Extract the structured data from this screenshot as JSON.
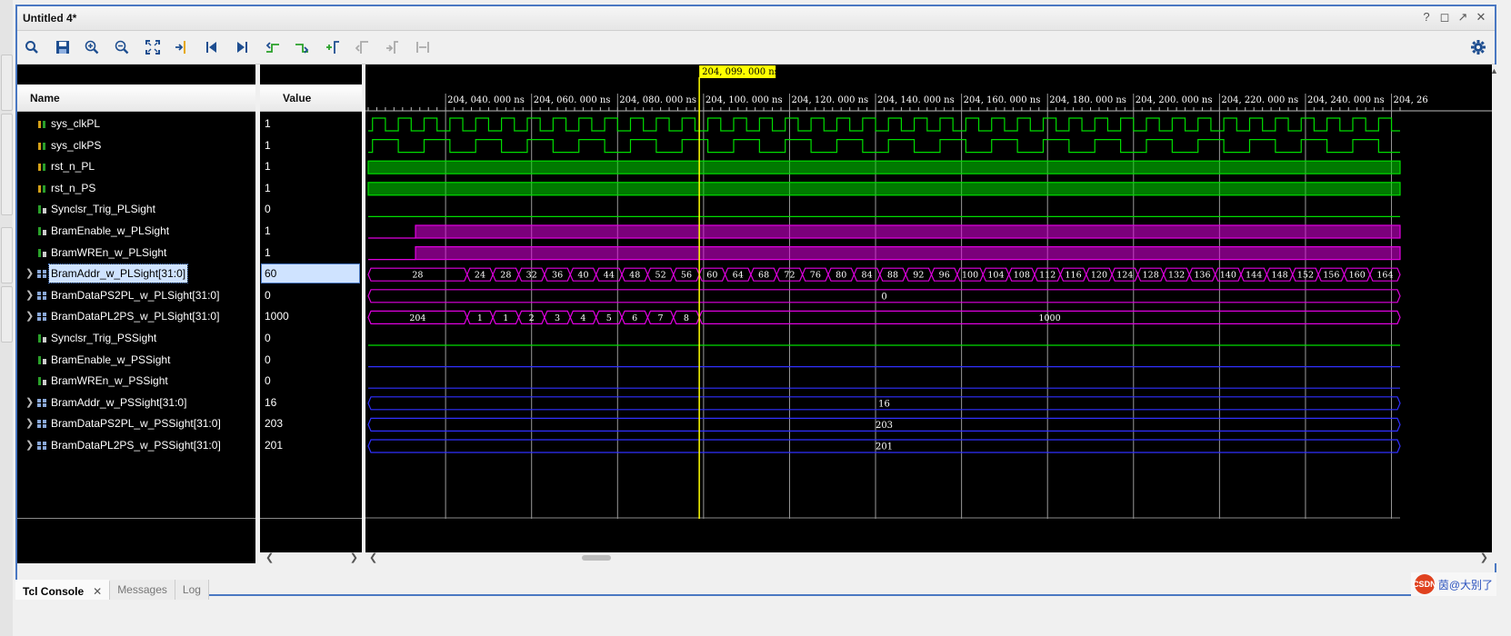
{
  "window": {
    "title": "Untitled 4*"
  },
  "title_controls": [
    "help-icon",
    "restore-icon",
    "float-icon",
    "close-icon"
  ],
  "toolbar": {
    "icons": [
      "search-icon",
      "save-icon",
      "zoom-in-icon",
      "zoom-out-icon",
      "zoom-fit-icon",
      "go-to-cursor-icon",
      "go-to-time-0-icon",
      "go-to-last-time-icon",
      "previous-transition-icon",
      "next-transition-icon",
      "add-marker-icon",
      "previous-marker-icon",
      "next-marker-icon",
      "swap-cursors-icon"
    ],
    "settings_icon": "gear-icon"
  },
  "headers": {
    "name": "Name",
    "value": "Value"
  },
  "signals": [
    {
      "name": "sys_clkPL",
      "value": "1",
      "type": "clock",
      "expand": false,
      "icon": "bit-signal-icon"
    },
    {
      "name": "sys_clkPS",
      "value": "1",
      "type": "clock",
      "expand": false,
      "icon": "bit-signal-icon"
    },
    {
      "name": "rst_n_PL",
      "value": "1",
      "type": "bit-high",
      "expand": false,
      "icon": "bit-signal-icon"
    },
    {
      "name": "rst_n_PS",
      "value": "1",
      "type": "bit-high",
      "expand": false,
      "icon": "bit-signal-icon"
    },
    {
      "name": "Synclsr_Trig_PLSight",
      "value": "0",
      "type": "bit-low",
      "expand": false,
      "icon": "wire-signal-icon"
    },
    {
      "name": "BramEnable_w_PLSight",
      "value": "1",
      "type": "bit-rise",
      "expand": false,
      "icon": "wire-signal-icon"
    },
    {
      "name": "BramWREn_w_PLSight",
      "value": "1",
      "type": "bit-rise",
      "expand": false,
      "icon": "wire-signal-icon"
    },
    {
      "name": "BramAddr_w_PLSight[31:0]",
      "value": "60",
      "type": "bus-addr",
      "expand": true,
      "icon": "bus-signal-icon",
      "selected": true
    },
    {
      "name": "BramDataPS2PL_w_PLSight[31:0]",
      "value": "0",
      "type": "bus-const",
      "expand": true,
      "icon": "bus-signal-icon"
    },
    {
      "name": "BramDataPL2PS_w_PLSight[31:0]",
      "value": "1000",
      "type": "bus-data",
      "expand": true,
      "icon": "bus-signal-icon"
    },
    {
      "name": "Synclsr_Trig_PSSight",
      "value": "0",
      "type": "bit-low",
      "expand": false,
      "icon": "wire-signal-icon"
    },
    {
      "name": "BramEnable_w_PSSight",
      "value": "0",
      "type": "bit-low-blue",
      "expand": false,
      "icon": "wire-signal-icon"
    },
    {
      "name": "BramWREn_w_PSSight",
      "value": "0",
      "type": "bit-low-blue",
      "expand": false,
      "icon": "wire-signal-icon"
    },
    {
      "name": "BramAddr_w_PSSight[31:0]",
      "value": "16",
      "type": "bus-blue",
      "expand": true,
      "icon": "bus-signal-icon"
    },
    {
      "name": "BramDataPS2PL_w_PSSight[31:0]",
      "value": "203",
      "type": "bus-blue",
      "expand": true,
      "icon": "bus-signal-icon"
    },
    {
      "name": "BramDataPL2PS_w_PSSight[31:0]",
      "value": "201",
      "type": "bus-blue",
      "expand": true,
      "icon": "bus-signal-icon"
    }
  ],
  "waveform": {
    "cursor_label": "204, 099. 000 ns",
    "cursor_time_ns": 204099,
    "view_start_ns": 204022,
    "view_end_ns": 204262,
    "time_labels": [
      "204, 040. 000 ns",
      "204, 060. 000 ns",
      "204, 080. 000 ns",
      "204, 100. 000 ns",
      "204, 120. 000 ns",
      "204, 140. 000 ns",
      "204, 160. 000 ns",
      "204, 180. 000 ns",
      "204, 200. 000 ns",
      "204, 220. 000 ns",
      "204, 240. 000 ns",
      "204, 26"
    ],
    "time_ticks_ns": [
      204040,
      204060,
      204080,
      204100,
      204120,
      204140,
      204160,
      204180,
      204200,
      204220,
      204240,
      204260
    ],
    "colors": {
      "green": "#00dd00",
      "magenta": "#e000e0",
      "blue": "#3030ff",
      "cursor": "#ffff00",
      "cursor_label_bg": "#ffff00",
      "grid": "#9a9a9a"
    },
    "clockPL_period_ns": 6,
    "clockPS_period_ns": 12,
    "enable_rise_ns": 204033,
    "addr_values": [
      "28",
      "24",
      "28",
      "32",
      "36",
      "40",
      "44",
      "48",
      "52",
      "56",
      "60",
      "64",
      "68",
      "72",
      "76",
      "80",
      "84",
      "88",
      "92",
      "96",
      "100",
      "104",
      "108",
      "112",
      "116",
      "120",
      "124",
      "128",
      "132",
      "136",
      "140",
      "144",
      "148",
      "152",
      "156",
      "160",
      "164"
    ],
    "addr_first_change_ns": 204045,
    "addr_step_ns": 6,
    "ps2pl_value": "0",
    "pl2ps_values": [
      "204",
      "1",
      "1",
      "2",
      "3",
      "4",
      "5",
      "6",
      "7",
      "8",
      "1000"
    ],
    "pl2ps_first_change_ns": 204045,
    "pl2ps_step_ns": 6,
    "ps_addr_value": "16",
    "ps_ps2pl_value": "203",
    "ps_pl2ps_value": "201"
  },
  "bottom_tabs": [
    {
      "label": "Tcl Console",
      "active": true,
      "closable": true
    },
    {
      "label": "Messages",
      "active": false,
      "closable": false
    },
    {
      "label": "Log",
      "active": false,
      "closable": false
    }
  ],
  "watermark": {
    "logo": "CSDN",
    "text": "茵@大别了"
  }
}
